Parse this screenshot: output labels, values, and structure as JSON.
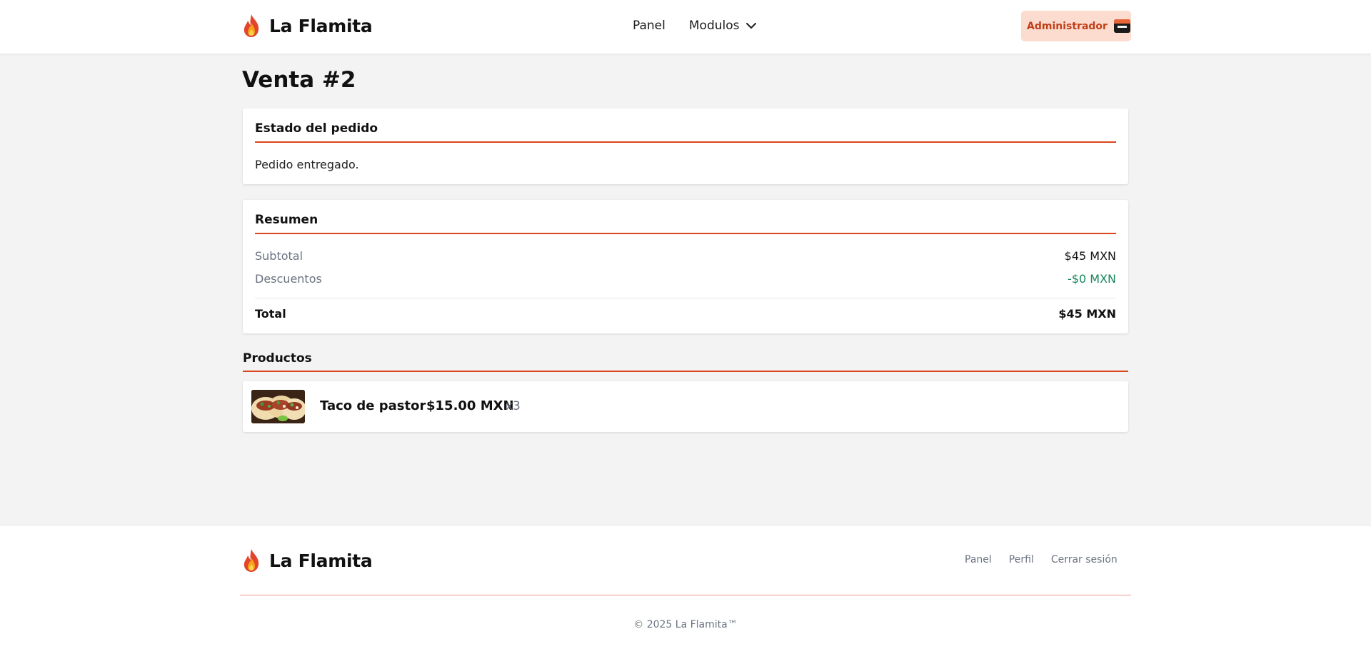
{
  "brand": {
    "name": "La Flamita"
  },
  "header": {
    "nav": {
      "panel": "Panel",
      "modulos": "Modulos"
    },
    "user_button": "Administrador"
  },
  "page": {
    "title": "Venta #2"
  },
  "status_card": {
    "title": "Estado del pedido",
    "text": "Pedido entregado."
  },
  "summary": {
    "title": "Resumen",
    "subtotal_label": "Subtotal",
    "subtotal_value": "$45 MXN",
    "discount_label": "Descuentos",
    "discount_value": "-$0 MXN",
    "total_label": "Total",
    "total_value": "$45 MXN"
  },
  "products": {
    "title": "Productos",
    "items": [
      {
        "name": "Taco de pastor",
        "price": "$15.00 MXN",
        "qty": "x3"
      }
    ]
  },
  "footer": {
    "links": {
      "panel": "Panel",
      "perfil": "Perfil",
      "logout": "Cerrar sesión"
    },
    "copyright": "© 2025 La Flamita™"
  },
  "colors": {
    "accent": "#d9461b",
    "admin_bg": "#fcdccf",
    "admin_text": "#c0401a",
    "discount": "#16865a",
    "muted": "#6b7280"
  },
  "icons": {
    "brand_logo": "flame-icon",
    "dropdown": "chevron-down-icon",
    "user_avatar": "avatar",
    "product_image": "taco-image"
  }
}
